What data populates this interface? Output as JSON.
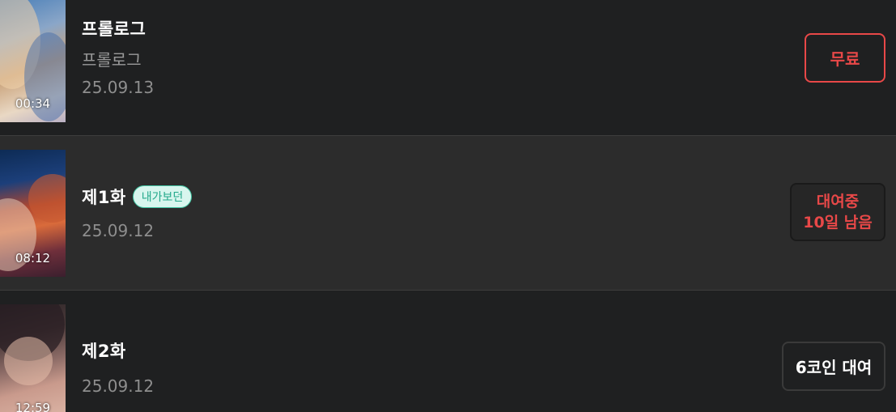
{
  "episodes": [
    {
      "thumb_duration": "00:34",
      "title": "프롤로그",
      "subtitle": "프롤로그",
      "date": "25.09.13",
      "action": {
        "label": "무료"
      }
    },
    {
      "thumb_duration": "08:12",
      "title": "제1화",
      "badge": "내가보던",
      "date": "25.09.12",
      "action": {
        "line1": "대여중",
        "line2": "10일 남음"
      }
    },
    {
      "thumb_duration": "12:59",
      "title": "제2화",
      "date": "25.09.12",
      "action": {
        "label": "6코인 대여"
      }
    }
  ],
  "colors": {
    "background": "#1f2021",
    "highlight_row": "#2c2c2c",
    "accent_red": "#e84848",
    "badge_green": "#22a88a",
    "badge_bg": "#d8f6ee"
  },
  "icons": [
    "thumbnail-image"
  ]
}
